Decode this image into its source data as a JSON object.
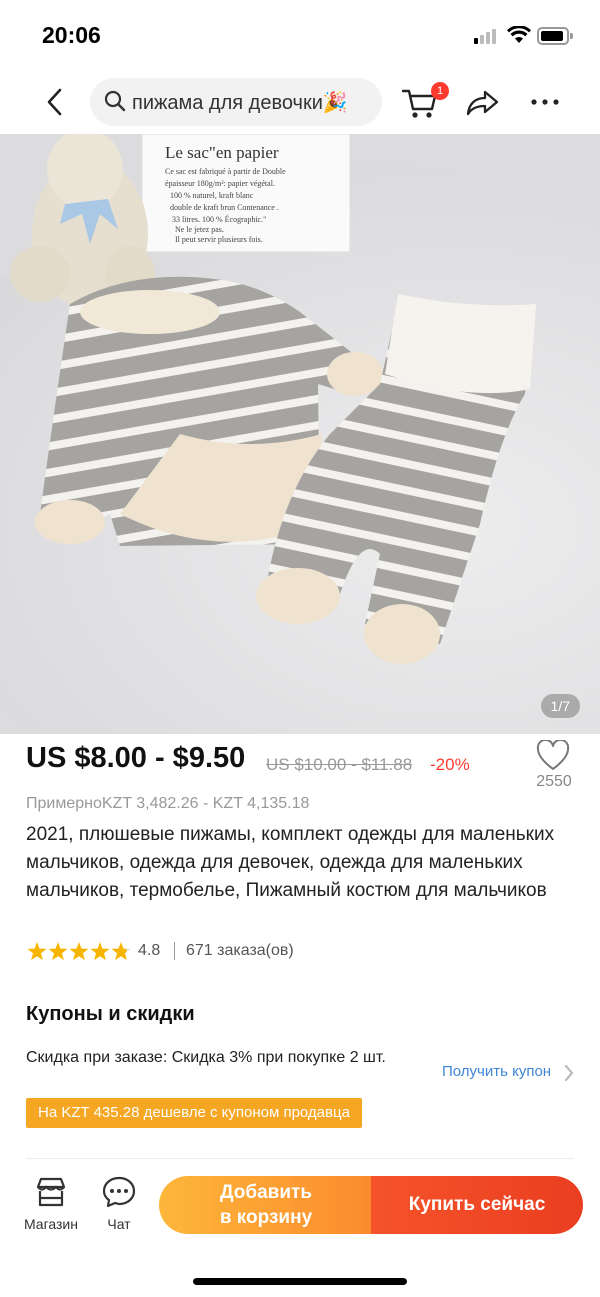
{
  "status_bar": {
    "time": "20:06"
  },
  "search": {
    "query": "пижама для девочки🎉"
  },
  "cart": {
    "badge": "1"
  },
  "gallery": {
    "counter": "1/7",
    "bag_text": "Le sac\"en papier",
    "bag_small_lines": [
      "Ce sac est fabriqué à partir de Double",
      "épaisseur 180g/m²: papier végétal.",
      "100 % naturel, kraft blanc",
      "double de kraft brun Contenance .",
      "33 litres. 100 % Écographic.\"",
      "Ne le jetez pas.",
      "Il peut servir plusieurs fois."
    ]
  },
  "price": {
    "main": "US $8.00 - $9.50",
    "old": "US $10.00 - $11.88",
    "discount": "-20%",
    "approx": "ПримерноKZT 3,482.26 - KZT 4,135.18"
  },
  "wishlist": {
    "count": "2550"
  },
  "product": {
    "title": "2021, плюшевые пижамы, комплект одежды для маленьких мальчиков, одежда для девочек, одежда для маленьких мальчиков, термобелье, Пижамный костюм для мальчиков"
  },
  "rating": {
    "value": "4.8",
    "stars": 4.8,
    "orders": "671 заказа(ов)"
  },
  "coupons": {
    "title": "Купоны и скидки",
    "description": "Скидка при заказе: Скидка 3% при покупке 2 шт.",
    "get_label": "Получить купон",
    "tag": "На KZT 435.28 дешевле с купоном продавца"
  },
  "bottom_bar": {
    "store_label": "Магазин",
    "chat_label": "Чат",
    "add_to_cart_line1": "Добавить",
    "add_to_cart_line2": "в корзину",
    "buy_now": "Купить сейчас"
  },
  "colors": {
    "accent_red": "#ff3b30",
    "coupon_orange": "#f5a623",
    "link_blue": "#3f87d6",
    "cart_orange": "#fb8b2d",
    "buy_red": "#ea3e20"
  }
}
